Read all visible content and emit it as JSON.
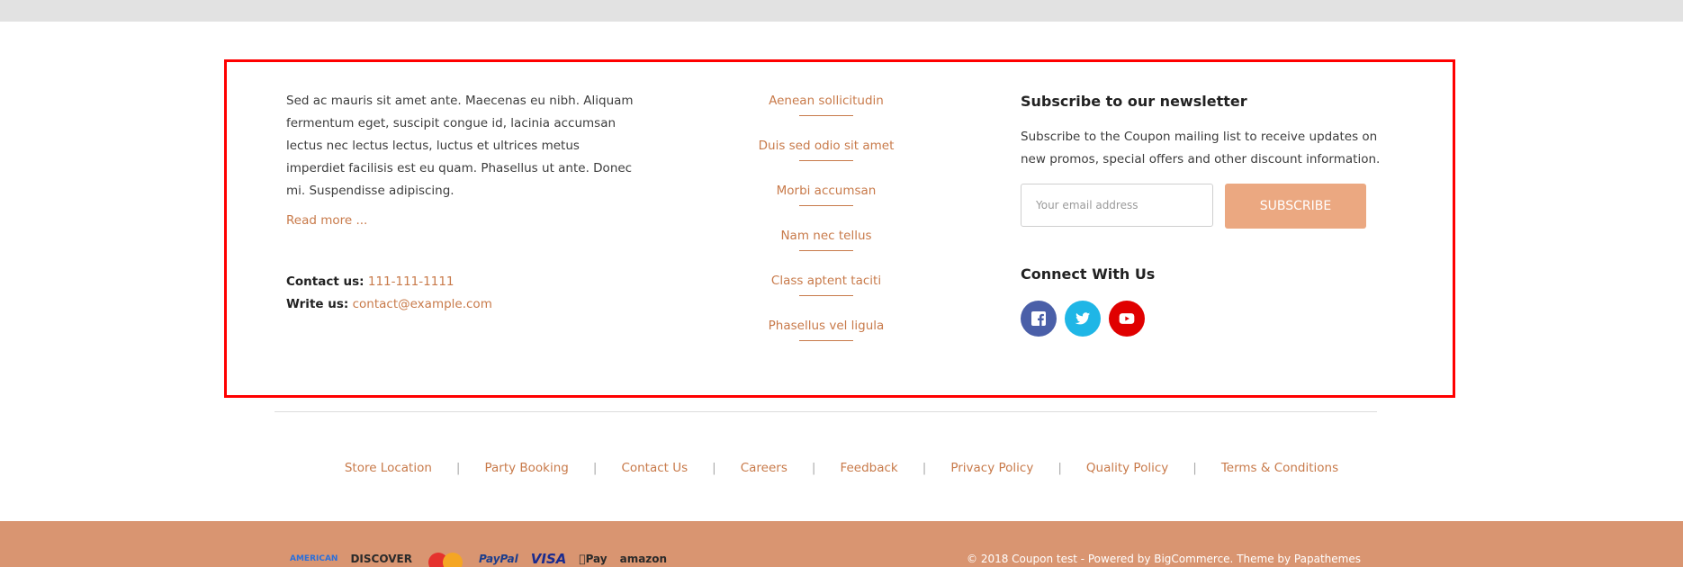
{
  "footer": {
    "about": {
      "text": "Sed ac mauris sit amet ante. Maecenas eu nibh. Aliquam fermentum eget, suscipit congue id, lacinia accumsan lectus nec lectus lectus, luctus et ultrices metus imperdiet facilisis est eu quam. Phasellus ut ante. Donec mi. Suspendisse adipiscing.",
      "read_more": "Read more ..."
    },
    "contact": {
      "phone_label": "Contact us:",
      "phone": "111-111-1111",
      "email_label": "Write us:",
      "email": "contact@example.com"
    },
    "links": [
      "Aenean sollicitudin",
      "Duis sed odio sit amet",
      "Morbi accumsan",
      "Nam nec tellus",
      "Class aptent taciti",
      "Phasellus vel ligula"
    ],
    "newsletter": {
      "title": "Subscribe to our newsletter",
      "description": "Subscribe to the Coupon mailing list to receive updates on new promos, special offers and other discount information.",
      "placeholder": "Your email address",
      "button": "SUBSCRIBE"
    },
    "connect": {
      "title": "Connect With Us",
      "icons": [
        "facebook-icon",
        "twitter-icon",
        "youtube-icon"
      ],
      "colors": {
        "facebook": "#4a5fa8",
        "twitter": "#1fb6e6",
        "youtube": "#e00000"
      }
    },
    "bottom_nav": [
      "Store Location",
      "Party Booking",
      "Contact Us",
      "Careers",
      "Feedback",
      "Privacy Policy",
      "Quality Policy",
      "Terms & Conditions"
    ],
    "payments": [
      "AMERICAN",
      "DISCOVER",
      "PayPal",
      "VISA",
      "Pay",
      "amazon"
    ],
    "copyright": "© 2018 Coupon test - Powered by BigCommerce. Theme by Papathemes"
  },
  "colors": {
    "accent": "#c87a4a",
    "subscribe_button": "#eba881",
    "bottom_bar": "#d99571",
    "highlight": "#ff0000"
  }
}
